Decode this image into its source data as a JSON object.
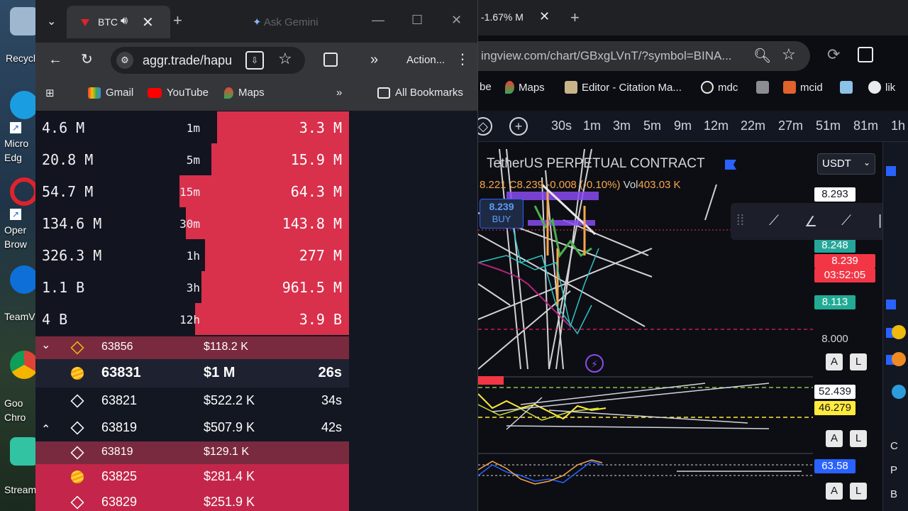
{
  "desktop": {
    "icons": [
      {
        "label": "Recycl",
        "name": "recycle-bin"
      },
      {
        "label": "Micro Edg",
        "name": "microsoft-edge"
      },
      {
        "label": "Oper Brow",
        "name": "opera-browser"
      },
      {
        "label": "TeamV",
        "name": "teamviewer"
      },
      {
        "label": "Goo Chro",
        "name": "google-chrome"
      },
      {
        "label": "Stream",
        "name": "streamlabs"
      }
    ]
  },
  "left_window": {
    "tab": {
      "title": "BTC"
    },
    "gemini": "Ask Gemini",
    "url": "aggr.trade/hapu",
    "action_label": "Action...",
    "bookmarks": [
      "Gmail",
      "YouTube",
      "Maps",
      "All Bookmarks"
    ],
    "stats_rows": [
      {
        "volume": "4.6 M",
        "period": "1m",
        "sell": "3.3 M",
        "fill": 0.42
      },
      {
        "volume": "20.8 M",
        "period": "5m",
        "sell": "15.9 M",
        "fill": 0.44
      },
      {
        "volume": "54.7 M",
        "period": "15m",
        "sell": "64.3 M",
        "fill": 0.54
      },
      {
        "volume": "134.6 M",
        "period": "30m",
        "sell": "143.8 M",
        "fill": 0.52
      },
      {
        "volume": "326.3 M",
        "period": "1h",
        "sell": "277 M",
        "fill": 0.46
      },
      {
        "volume": "1.1 B",
        "period": "3h",
        "sell": "961.5 M",
        "fill": 0.47
      },
      {
        "volume": "4 B",
        "period": "12h",
        "sell": "3.9 B",
        "fill": 0.49
      }
    ],
    "trades": [
      {
        "arrow": "chevron-down",
        "exchange": "binance",
        "price": "63856",
        "amount": "$118.2 K",
        "time": "",
        "side": "sell-dark"
      },
      {
        "arrow": "",
        "exchange": "bybit",
        "price": "63831",
        "amount": "$1 M",
        "time": "26s",
        "side": "buy-big"
      },
      {
        "arrow": "",
        "exchange": "binance",
        "price": "63821",
        "amount": "$522.2 K",
        "time": "34s",
        "side": "buy"
      },
      {
        "arrow": "chevron-up",
        "exchange": "binance",
        "price": "63819",
        "amount": "$507.9 K",
        "time": "42s",
        "side": "buy"
      },
      {
        "arrow": "",
        "exchange": "binance",
        "price": "63819",
        "amount": "$129.1 K",
        "time": "",
        "side": "sell-dark"
      },
      {
        "arrow": "",
        "exchange": "bybit",
        "price": "63825",
        "amount": "$281.4 K",
        "time": "",
        "side": "sell"
      },
      {
        "arrow": "",
        "exchange": "binance",
        "price": "63829",
        "amount": "$251.9 K",
        "time": "",
        "side": "sell"
      }
    ]
  },
  "right_window": {
    "tab_title": "-1.67% M",
    "url": "ingview.com/chart/GBxgLVnT/?symbol=BINA...",
    "bookmarks": [
      "be",
      "Maps",
      "Editor - Citation Ma...",
      "mdc",
      "mcid",
      "lik"
    ],
    "timeframes": [
      "30s",
      "1m",
      "3m",
      "5m",
      "9m",
      "12m",
      "22m",
      "27m",
      "51m",
      "81m",
      "1h"
    ],
    "symbol": "TetherUS PERPETUAL CONTRACT",
    "ohlc": "8.221 C8.239 -0.008 (-0.10%)",
    "vol_label": "Vol",
    "vol_value": "403.03 K",
    "buy_price": "8.239",
    "buy_label": "BUY",
    "currency": "USDT",
    "price_labels": [
      {
        "text": "8.293",
        "bg": "#ffffff",
        "fg": "#131722"
      },
      {
        "text": "8.248",
        "bg": "#26a69a",
        "fg": "#ffffff"
      },
      {
        "text": "8.239",
        "bg": "#f23645",
        "fg": "#ffffff"
      },
      {
        "text": "03:52:05",
        "bg": "#f23645",
        "fg": "#ffffff"
      },
      {
        "text": "8.113",
        "bg": "#22ab94",
        "fg": "#ffffff"
      },
      {
        "text": "8.000",
        "bg": "",
        "fg": "#d1d4dc"
      },
      {
        "text": "52.439",
        "bg": "#ffffff",
        "fg": "#131722"
      },
      {
        "text": "46.279",
        "bg": "#ffeb3b",
        "fg": "#131722"
      },
      {
        "text": "63.58",
        "bg": "#2962ff",
        "fg": "#ffffff"
      }
    ],
    "a_label": "A",
    "l_label": "L",
    "sidebar_letters": [
      "C",
      "P",
      "B"
    ]
  }
}
